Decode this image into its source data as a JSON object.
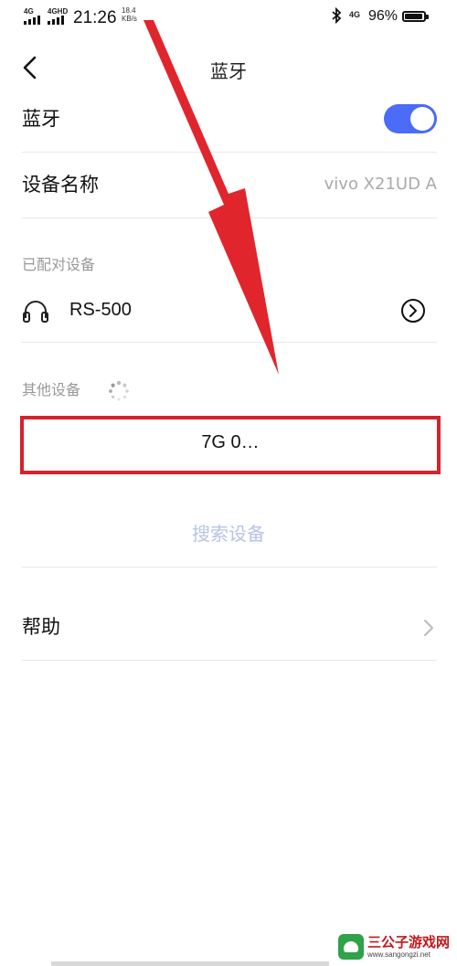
{
  "status_bar": {
    "net1": "4G",
    "net2": "4GHD",
    "time": "21:26",
    "speed_value": "18.4",
    "speed_unit": "KB/s",
    "bluetooth_icon": "bluetooth-icon",
    "net3": "4G",
    "battery": "96%"
  },
  "header": {
    "title": "蓝牙",
    "back_icon": "back-arrow-icon"
  },
  "bluetooth": {
    "label": "蓝牙",
    "enabled": true,
    "toggle_color": "#4a6cf7"
  },
  "device_name": {
    "label": "设备名称",
    "value": "vivo X21UD A"
  },
  "paired": {
    "section_title": "已配对设备",
    "items": [
      {
        "name": "RS-500",
        "icon": "headphones-icon",
        "action_icon": "chevron-right-circle-icon"
      }
    ]
  },
  "other": {
    "section_title": "其他设备",
    "spinner_icon": "loading-spinner-icon",
    "items": [
      {
        "name": "7G    0…"
      }
    ]
  },
  "search_button": {
    "label": "搜索设备",
    "color": "#b8c4e6"
  },
  "help": {
    "label": "帮助",
    "icon": "chevron-right-icon"
  },
  "annotation": {
    "highlight_color": "#d6222b",
    "arrow_color": "#e0262c"
  },
  "watermark": {
    "title": "三公子游戏网",
    "url": "www.sangongzi.net"
  }
}
